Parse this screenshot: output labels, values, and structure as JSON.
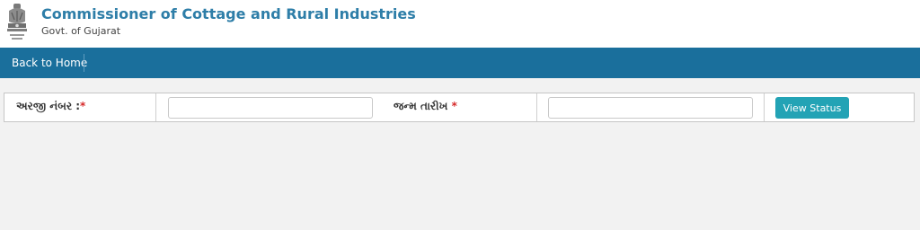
{
  "header": {
    "title": "Commissioner of Cottage and Rural Industries",
    "subtitle": "Govt. of Gujarat",
    "emblem_icon": "national-emblem-icon"
  },
  "nav": {
    "back_home_label": "Back to Home"
  },
  "form": {
    "application_number_label": "અરજી નંબર :",
    "application_number_value": "",
    "birth_date_label": "જન્મ તારીખ ",
    "birth_date_value": "",
    "required_marker": "*",
    "view_status_label": "View Status"
  },
  "colors": {
    "title": "#2e7ea8",
    "navbar": "#1a6f9c",
    "button": "#23a3b5",
    "required": "#d62828",
    "background": "#f2f2f2"
  }
}
